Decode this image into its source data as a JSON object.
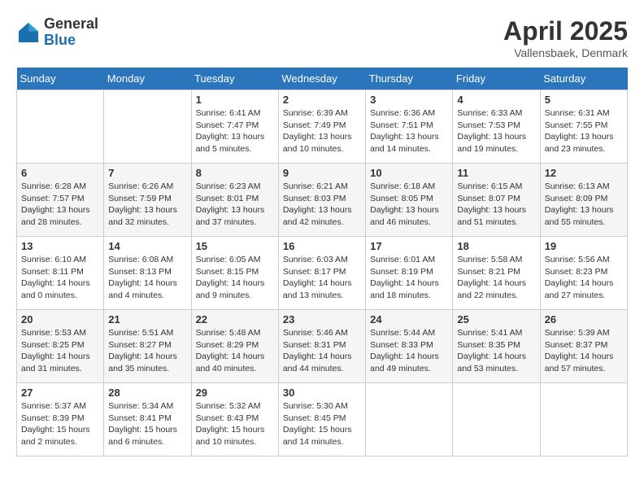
{
  "header": {
    "logo_general": "General",
    "logo_blue": "Blue",
    "month": "April 2025",
    "location": "Vallensbaek, Denmark"
  },
  "days_of_week": [
    "Sunday",
    "Monday",
    "Tuesday",
    "Wednesday",
    "Thursday",
    "Friday",
    "Saturday"
  ],
  "weeks": [
    [
      {
        "day": "",
        "info": ""
      },
      {
        "day": "",
        "info": ""
      },
      {
        "day": "1",
        "info": "Sunrise: 6:41 AM\nSunset: 7:47 PM\nDaylight: 13 hours and 5 minutes."
      },
      {
        "day": "2",
        "info": "Sunrise: 6:39 AM\nSunset: 7:49 PM\nDaylight: 13 hours and 10 minutes."
      },
      {
        "day": "3",
        "info": "Sunrise: 6:36 AM\nSunset: 7:51 PM\nDaylight: 13 hours and 14 minutes."
      },
      {
        "day": "4",
        "info": "Sunrise: 6:33 AM\nSunset: 7:53 PM\nDaylight: 13 hours and 19 minutes."
      },
      {
        "day": "5",
        "info": "Sunrise: 6:31 AM\nSunset: 7:55 PM\nDaylight: 13 hours and 23 minutes."
      }
    ],
    [
      {
        "day": "6",
        "info": "Sunrise: 6:28 AM\nSunset: 7:57 PM\nDaylight: 13 hours and 28 minutes."
      },
      {
        "day": "7",
        "info": "Sunrise: 6:26 AM\nSunset: 7:59 PM\nDaylight: 13 hours and 32 minutes."
      },
      {
        "day": "8",
        "info": "Sunrise: 6:23 AM\nSunset: 8:01 PM\nDaylight: 13 hours and 37 minutes."
      },
      {
        "day": "9",
        "info": "Sunrise: 6:21 AM\nSunset: 8:03 PM\nDaylight: 13 hours and 42 minutes."
      },
      {
        "day": "10",
        "info": "Sunrise: 6:18 AM\nSunset: 8:05 PM\nDaylight: 13 hours and 46 minutes."
      },
      {
        "day": "11",
        "info": "Sunrise: 6:15 AM\nSunset: 8:07 PM\nDaylight: 13 hours and 51 minutes."
      },
      {
        "day": "12",
        "info": "Sunrise: 6:13 AM\nSunset: 8:09 PM\nDaylight: 13 hours and 55 minutes."
      }
    ],
    [
      {
        "day": "13",
        "info": "Sunrise: 6:10 AM\nSunset: 8:11 PM\nDaylight: 14 hours and 0 minutes."
      },
      {
        "day": "14",
        "info": "Sunrise: 6:08 AM\nSunset: 8:13 PM\nDaylight: 14 hours and 4 minutes."
      },
      {
        "day": "15",
        "info": "Sunrise: 6:05 AM\nSunset: 8:15 PM\nDaylight: 14 hours and 9 minutes."
      },
      {
        "day": "16",
        "info": "Sunrise: 6:03 AM\nSunset: 8:17 PM\nDaylight: 14 hours and 13 minutes."
      },
      {
        "day": "17",
        "info": "Sunrise: 6:01 AM\nSunset: 8:19 PM\nDaylight: 14 hours and 18 minutes."
      },
      {
        "day": "18",
        "info": "Sunrise: 5:58 AM\nSunset: 8:21 PM\nDaylight: 14 hours and 22 minutes."
      },
      {
        "day": "19",
        "info": "Sunrise: 5:56 AM\nSunset: 8:23 PM\nDaylight: 14 hours and 27 minutes."
      }
    ],
    [
      {
        "day": "20",
        "info": "Sunrise: 5:53 AM\nSunset: 8:25 PM\nDaylight: 14 hours and 31 minutes."
      },
      {
        "day": "21",
        "info": "Sunrise: 5:51 AM\nSunset: 8:27 PM\nDaylight: 14 hours and 35 minutes."
      },
      {
        "day": "22",
        "info": "Sunrise: 5:48 AM\nSunset: 8:29 PM\nDaylight: 14 hours and 40 minutes."
      },
      {
        "day": "23",
        "info": "Sunrise: 5:46 AM\nSunset: 8:31 PM\nDaylight: 14 hours and 44 minutes."
      },
      {
        "day": "24",
        "info": "Sunrise: 5:44 AM\nSunset: 8:33 PM\nDaylight: 14 hours and 49 minutes."
      },
      {
        "day": "25",
        "info": "Sunrise: 5:41 AM\nSunset: 8:35 PM\nDaylight: 14 hours and 53 minutes."
      },
      {
        "day": "26",
        "info": "Sunrise: 5:39 AM\nSunset: 8:37 PM\nDaylight: 14 hours and 57 minutes."
      }
    ],
    [
      {
        "day": "27",
        "info": "Sunrise: 5:37 AM\nSunset: 8:39 PM\nDaylight: 15 hours and 2 minutes."
      },
      {
        "day": "28",
        "info": "Sunrise: 5:34 AM\nSunset: 8:41 PM\nDaylight: 15 hours and 6 minutes."
      },
      {
        "day": "29",
        "info": "Sunrise: 5:32 AM\nSunset: 8:43 PM\nDaylight: 15 hours and 10 minutes."
      },
      {
        "day": "30",
        "info": "Sunrise: 5:30 AM\nSunset: 8:45 PM\nDaylight: 15 hours and 14 minutes."
      },
      {
        "day": "",
        "info": ""
      },
      {
        "day": "",
        "info": ""
      },
      {
        "day": "",
        "info": ""
      }
    ]
  ]
}
